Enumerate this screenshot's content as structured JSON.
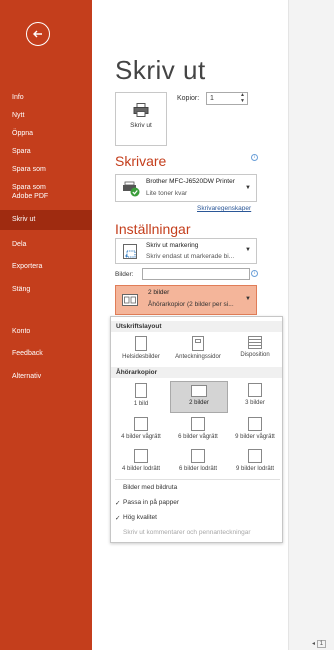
{
  "sidebar": {
    "items": [
      {
        "label": "Info"
      },
      {
        "label": "Nytt"
      },
      {
        "label": "Öppna"
      },
      {
        "label": "Spara"
      },
      {
        "label": "Spara som"
      },
      {
        "label": "Spara som\nAdobe PDF"
      },
      {
        "label": "Skriv ut"
      },
      {
        "label": "Dela"
      },
      {
        "label": "Exportera"
      },
      {
        "label": "Stäng"
      },
      {
        "label": "Konto"
      },
      {
        "label": "Feedback"
      },
      {
        "label": "Alternativ"
      }
    ],
    "active": "Skriv ut"
  },
  "page": {
    "title": "Skriv ut",
    "print_button_label": "Skriv ut",
    "copies_label": "Kopior:",
    "copies_value": "1"
  },
  "printer": {
    "section_title": "Skrivare",
    "name": "Brother MFC-J6520DW Printer",
    "status": "Lite toner kvar",
    "properties_link": "Skrivaregenskaper"
  },
  "settings": {
    "section_title": "Inställningar",
    "range_title": "Skriv ut markering",
    "range_desc": "Skriv endast ut markerade bi...",
    "pages_label": "Bilder:",
    "pages_value": "",
    "layout_title": "2 bilder",
    "layout_desc": "Åhörarkopior (2 bilder per si..."
  },
  "popup": {
    "layout_header": "Utskriftslayout",
    "layout_options": [
      {
        "label": "Helsidesbilder"
      },
      {
        "label": "Anteckningssidor"
      },
      {
        "label": "Disposition"
      }
    ],
    "handouts_header": "Åhörarkopior",
    "handouts": [
      {
        "label": "1 bild"
      },
      {
        "label": "2 bilder"
      },
      {
        "label": "3 bilder"
      },
      {
        "label": "4 bilder vågrätt"
      },
      {
        "label": "6 bilder vågrätt"
      },
      {
        "label": "9 bilder vågrätt"
      },
      {
        "label": "4 bilder lodrätt"
      },
      {
        "label": "6 bilder lodrätt"
      },
      {
        "label": "9 bilder lodrätt"
      }
    ],
    "selected_handout": "2 bilder",
    "checks": [
      {
        "label": "Bilder med bildruta",
        "checked": false,
        "enabled": true
      },
      {
        "label": "Passa in på papper",
        "checked": true,
        "enabled": true
      },
      {
        "label": "Hög kvalitet",
        "checked": true,
        "enabled": true
      },
      {
        "label": "Skriv ut kommentarer och pennanteckningar",
        "checked": false,
        "enabled": false
      }
    ]
  },
  "page_nav": {
    "current": "1"
  },
  "colors": {
    "accent": "#c43e1c",
    "accent_dark": "#9f2b10",
    "selected_dropdown": "#f4b59a"
  }
}
